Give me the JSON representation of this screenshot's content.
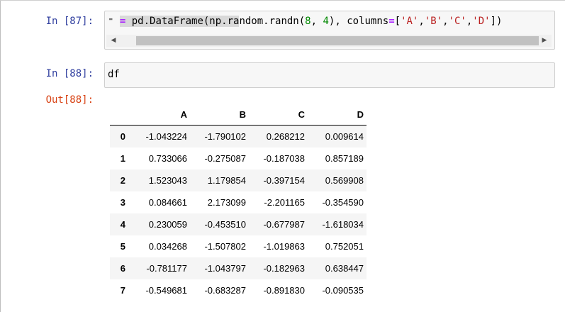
{
  "cell1": {
    "prompt": "In [87]:",
    "code_tokens": [
      {
        "t": "⁼ ",
        "c": "plain"
      },
      {
        "t": "=",
        "c": "op sel"
      },
      {
        "t": " pd.DataFrame(np.ra",
        "c": "plain sel"
      },
      {
        "t": "ndom.randn(",
        "c": "plain"
      },
      {
        "t": "8",
        "c": "num"
      },
      {
        "t": ", ",
        "c": "plain"
      },
      {
        "t": "4",
        "c": "num"
      },
      {
        "t": "), columns",
        "c": "plain"
      },
      {
        "t": "=",
        "c": "op"
      },
      {
        "t": "[",
        "c": "plain"
      },
      {
        "t": "'A'",
        "c": "str"
      },
      {
        "t": ",",
        "c": "plain"
      },
      {
        "t": "'B'",
        "c": "str"
      },
      {
        "t": ",",
        "c": "plain"
      },
      {
        "t": "'C'",
        "c": "str"
      },
      {
        "t": ",",
        "c": "plain"
      },
      {
        "t": "'D'",
        "c": "str"
      },
      {
        "t": "])",
        "c": "plain"
      }
    ],
    "scroll_left": "◀",
    "scroll_right": "▶"
  },
  "cell2": {
    "prompt": "In [88]:",
    "code": "df",
    "out_prompt": "Out[88]:"
  },
  "dataframe": {
    "columns": [
      "A",
      "B",
      "C",
      "D"
    ],
    "rows": [
      {
        "index": "0",
        "values": [
          "-1.043224",
          "-1.790102",
          "0.268212",
          "0.009614"
        ]
      },
      {
        "index": "1",
        "values": [
          "0.733066",
          "-0.275087",
          "-0.187038",
          "0.857189"
        ]
      },
      {
        "index": "2",
        "values": [
          "1.523043",
          "1.179854",
          "-0.397154",
          "0.569908"
        ]
      },
      {
        "index": "3",
        "values": [
          "0.084661",
          "2.173099",
          "-2.201165",
          "-0.354590"
        ]
      },
      {
        "index": "4",
        "values": [
          "0.230059",
          "-0.453510",
          "-0.677987",
          "-1.618034"
        ]
      },
      {
        "index": "5",
        "values": [
          "0.034268",
          "-1.507802",
          "-1.019863",
          "0.752051"
        ]
      },
      {
        "index": "6",
        "values": [
          "-0.781177",
          "-1.043797",
          "-0.182963",
          "0.638447"
        ]
      },
      {
        "index": "7",
        "values": [
          "-0.549681",
          "-0.683287",
          "-0.891830",
          "-0.090535"
        ]
      }
    ]
  }
}
